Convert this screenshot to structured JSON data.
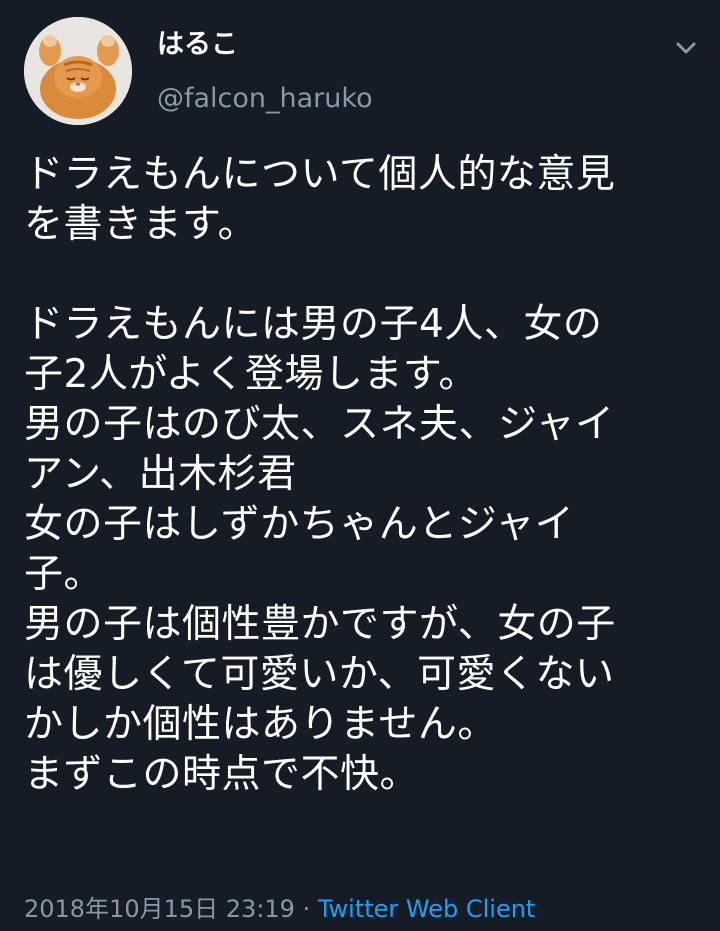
{
  "user": {
    "display_name": "はるこ",
    "handle": "@falcon_haruko",
    "avatar_icon": "cat-avatar-icon"
  },
  "menu": {
    "icon": "chevron-down-icon"
  },
  "tweet": {
    "lines": [
      "ドラえもんについて個人的な意見",
      "を書きます。",
      "",
      "ドラえもんには男の子4人、女の",
      "子2人がよく登場します。",
      "男の子はのび太、スネ夫、ジャイ",
      "アン、出木杉君",
      "女の子はしずかちゃんとジャイ",
      "子。",
      "男の子は個性豊かですが、女の子",
      "は優しくて可愛いか、可愛くない",
      "かしか個性はありません。",
      "まずこの時点で不快。"
    ]
  },
  "meta": {
    "timestamp": "2018年10月15日 23:19",
    "separator": " · ",
    "source": "Twitter Web Client"
  },
  "colors": {
    "background": "#151c25",
    "text": "#ffffff",
    "secondary": "#8899a6",
    "link": "#1da1f2"
  }
}
